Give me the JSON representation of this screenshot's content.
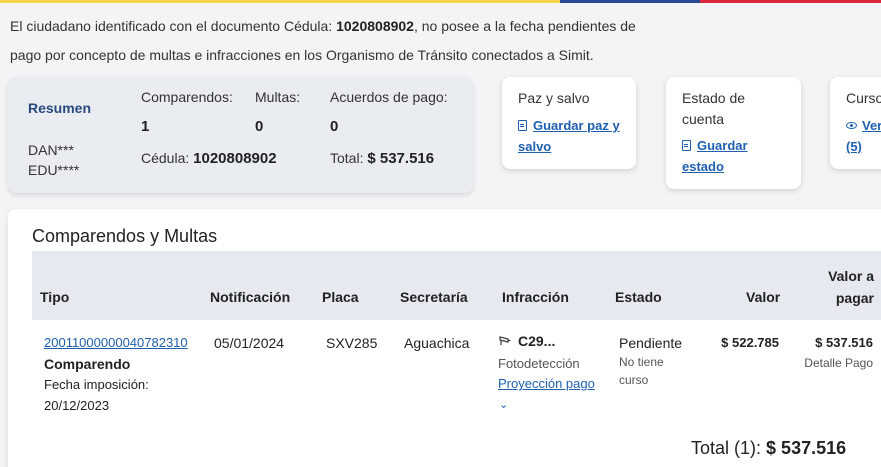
{
  "intro": {
    "prefix": "El ciudadano identificado con el documento Cédula: ",
    "document": "1020808902",
    "suffix": ", no posee a la fecha pendientes de pago por concepto de multas e infracciones en los Organismo de Tránsito conectados a Simit."
  },
  "summary": {
    "resumen_label": "Resumen",
    "name_first": "DAN***",
    "name_last": "EDU****",
    "comparendos_label": "Comparendos:",
    "comparendos_value": "1",
    "multas_label": "Multas:",
    "multas_value": "0",
    "acuerdos_label": "Acuerdos de pago:",
    "acuerdos_value": "0",
    "cedula_label": "Cédula:",
    "cedula_value": "1020808902",
    "total_label": "Total:",
    "total_value": "$ 537.516"
  },
  "cards": {
    "paz_title": "Paz y salvo",
    "paz_link_1": "Guardar paz y",
    "paz_link_2": "salvo",
    "estado_title_1": "Estado de",
    "estado_title_2": "cuenta",
    "estado_link_1": "Guardar",
    "estado_link_2": "estado",
    "cursos_title": "Cursos",
    "cursos_link_1": "Ver",
    "cursos_link_2": "(5)"
  },
  "table": {
    "title": "Comparendos y Multas",
    "headers": {
      "tipo": "Tipo",
      "notificacion": "Notificación",
      "placa": "Placa",
      "secretaria": "Secretaría",
      "infraccion": "Infracción",
      "estado": "Estado",
      "valor": "Valor",
      "valor_pagar_1": "Valor a",
      "valor_pagar_2": "pagar"
    },
    "row": {
      "numero": "20011000000040782310",
      "tipo": "Comparendo",
      "fecha_label": "Fecha imposición:",
      "fecha": "20/12/2023",
      "notificacion": "05/01/2024",
      "placa": "SXV285",
      "secretaria": "Aguachica",
      "infraccion_code": "C29...",
      "infraccion_sub": "Fotodetección",
      "proyeccion": "Proyección pago",
      "estado": "Pendiente",
      "estado_sub_1": "No tiene",
      "estado_sub_2": "curso",
      "valor": "$ 522.785",
      "valor_pagar": "$ 537.516",
      "detalle": "Detalle Pago"
    },
    "total_label": "Total (1):",
    "total_value": "$ 537.516"
  },
  "colors": {
    "link": "#1f5fb0",
    "header_bg": "#e6e9ef",
    "summary_bg": "#e9ecf1"
  }
}
